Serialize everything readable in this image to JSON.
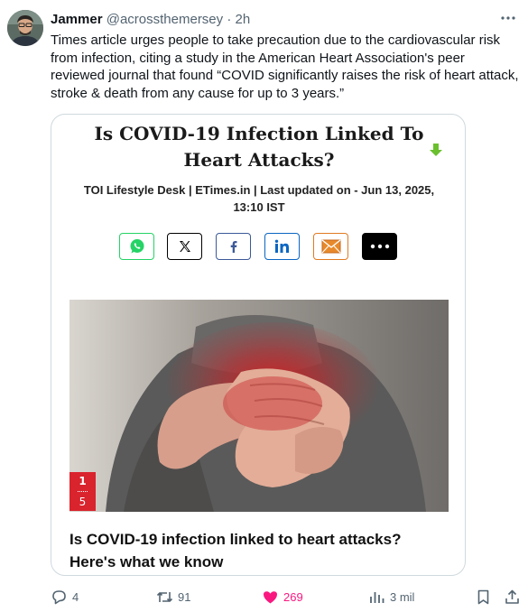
{
  "post": {
    "author_name": "Jammer",
    "author_handle": "@acrossthemersey",
    "separator": "·",
    "time": "2h",
    "text": "Times article urges people to take precaution due to the cardiovascular risk from infection, citing a study in the American Heart Association's peer reviewed journal that found “COVID significantly raises the risk of heart attack, stroke & death from any cause for up to 3 years.”"
  },
  "card": {
    "headline": "Is COVID-19 Infection Linked To Heart Attacks?",
    "byline": "TOI Lifestyle Desk | ETimes.in | Last updated on - Jun 13, 2025, 13:10 IST",
    "share_buttons": [
      {
        "icon": "whatsapp-icon",
        "color": "#25d366"
      },
      {
        "icon": "x-icon",
        "color": "#000000"
      },
      {
        "icon": "facebook-icon",
        "color": "#3b5998"
      },
      {
        "icon": "linkedin-icon",
        "color": "#0a66c2"
      },
      {
        "icon": "mail-icon",
        "color": "#e07b22"
      },
      {
        "icon": "more-dots-icon",
        "color": "#000000"
      }
    ],
    "slide_current": "1",
    "slide_total": "5",
    "caption": "Is COVID-19 infection linked to heart attacks? Here's what we know"
  },
  "actions": {
    "replies": "4",
    "reposts": "91",
    "likes": "269",
    "views": "3 mil"
  },
  "colors": {
    "text": "#0f1419",
    "secondary": "#536471",
    "like": "#f91880",
    "badge": "#d9232d",
    "arrow": "#6abf2e"
  }
}
